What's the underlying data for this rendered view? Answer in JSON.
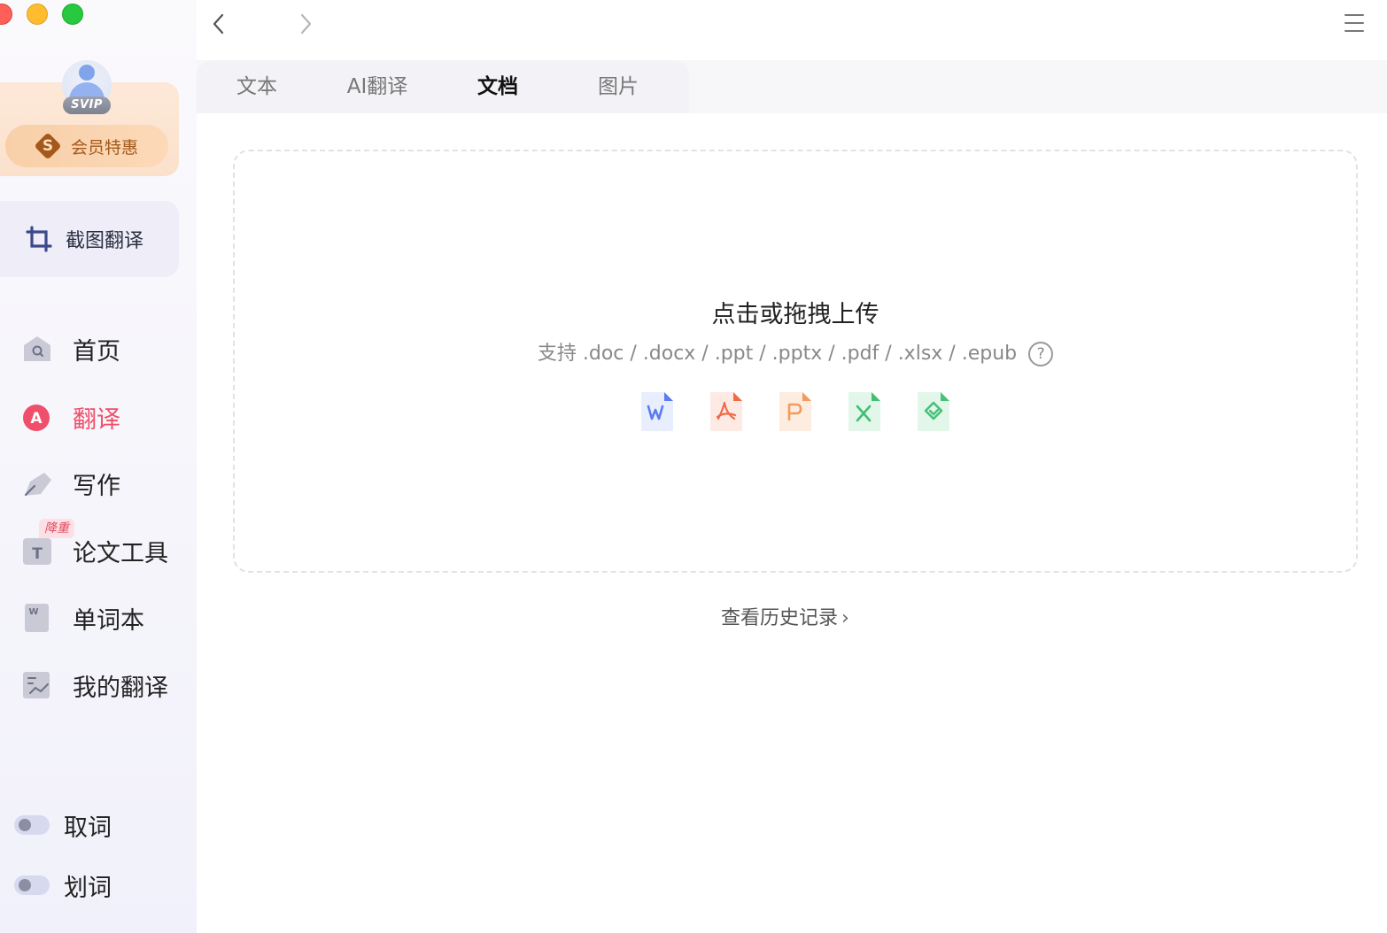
{
  "sidebar": {
    "vip": {
      "badge": "SVIP",
      "offer_label": "会员特惠"
    },
    "screenshot_translate": "截图翻译",
    "nav": [
      {
        "label": "首页",
        "icon": "home-icon"
      },
      {
        "label": "翻译",
        "icon": "translate-icon",
        "active": true
      },
      {
        "label": "写作",
        "icon": "pen-icon"
      },
      {
        "label": "论文工具",
        "icon": "paper-tool-icon",
        "badge": "降重"
      },
      {
        "label": "单词本",
        "icon": "wordbook-icon"
      },
      {
        "label": "我的翻译",
        "icon": "my-translation-icon"
      }
    ],
    "toggles": [
      {
        "label": "取词",
        "on": false
      },
      {
        "label": "划词",
        "on": false
      }
    ]
  },
  "tabs": [
    {
      "label": "文本"
    },
    {
      "label": "AI翻译"
    },
    {
      "label": "文档",
      "active": true
    },
    {
      "label": "图片"
    }
  ],
  "upload": {
    "title": "点击或拖拽上传",
    "supported": "支持 .doc / .docx / .ppt / .pptx / .pdf / .xlsx / .epub",
    "help": "?"
  },
  "history_link": "查看历史记录",
  "colors": {
    "accent_red": "#f04f6b",
    "word_blue": "#5b7cf0",
    "pdf_red": "#f06a45",
    "ppt_orange": "#f49a5c",
    "excel_green": "#3fbf70",
    "epub_green": "#47c07a"
  }
}
